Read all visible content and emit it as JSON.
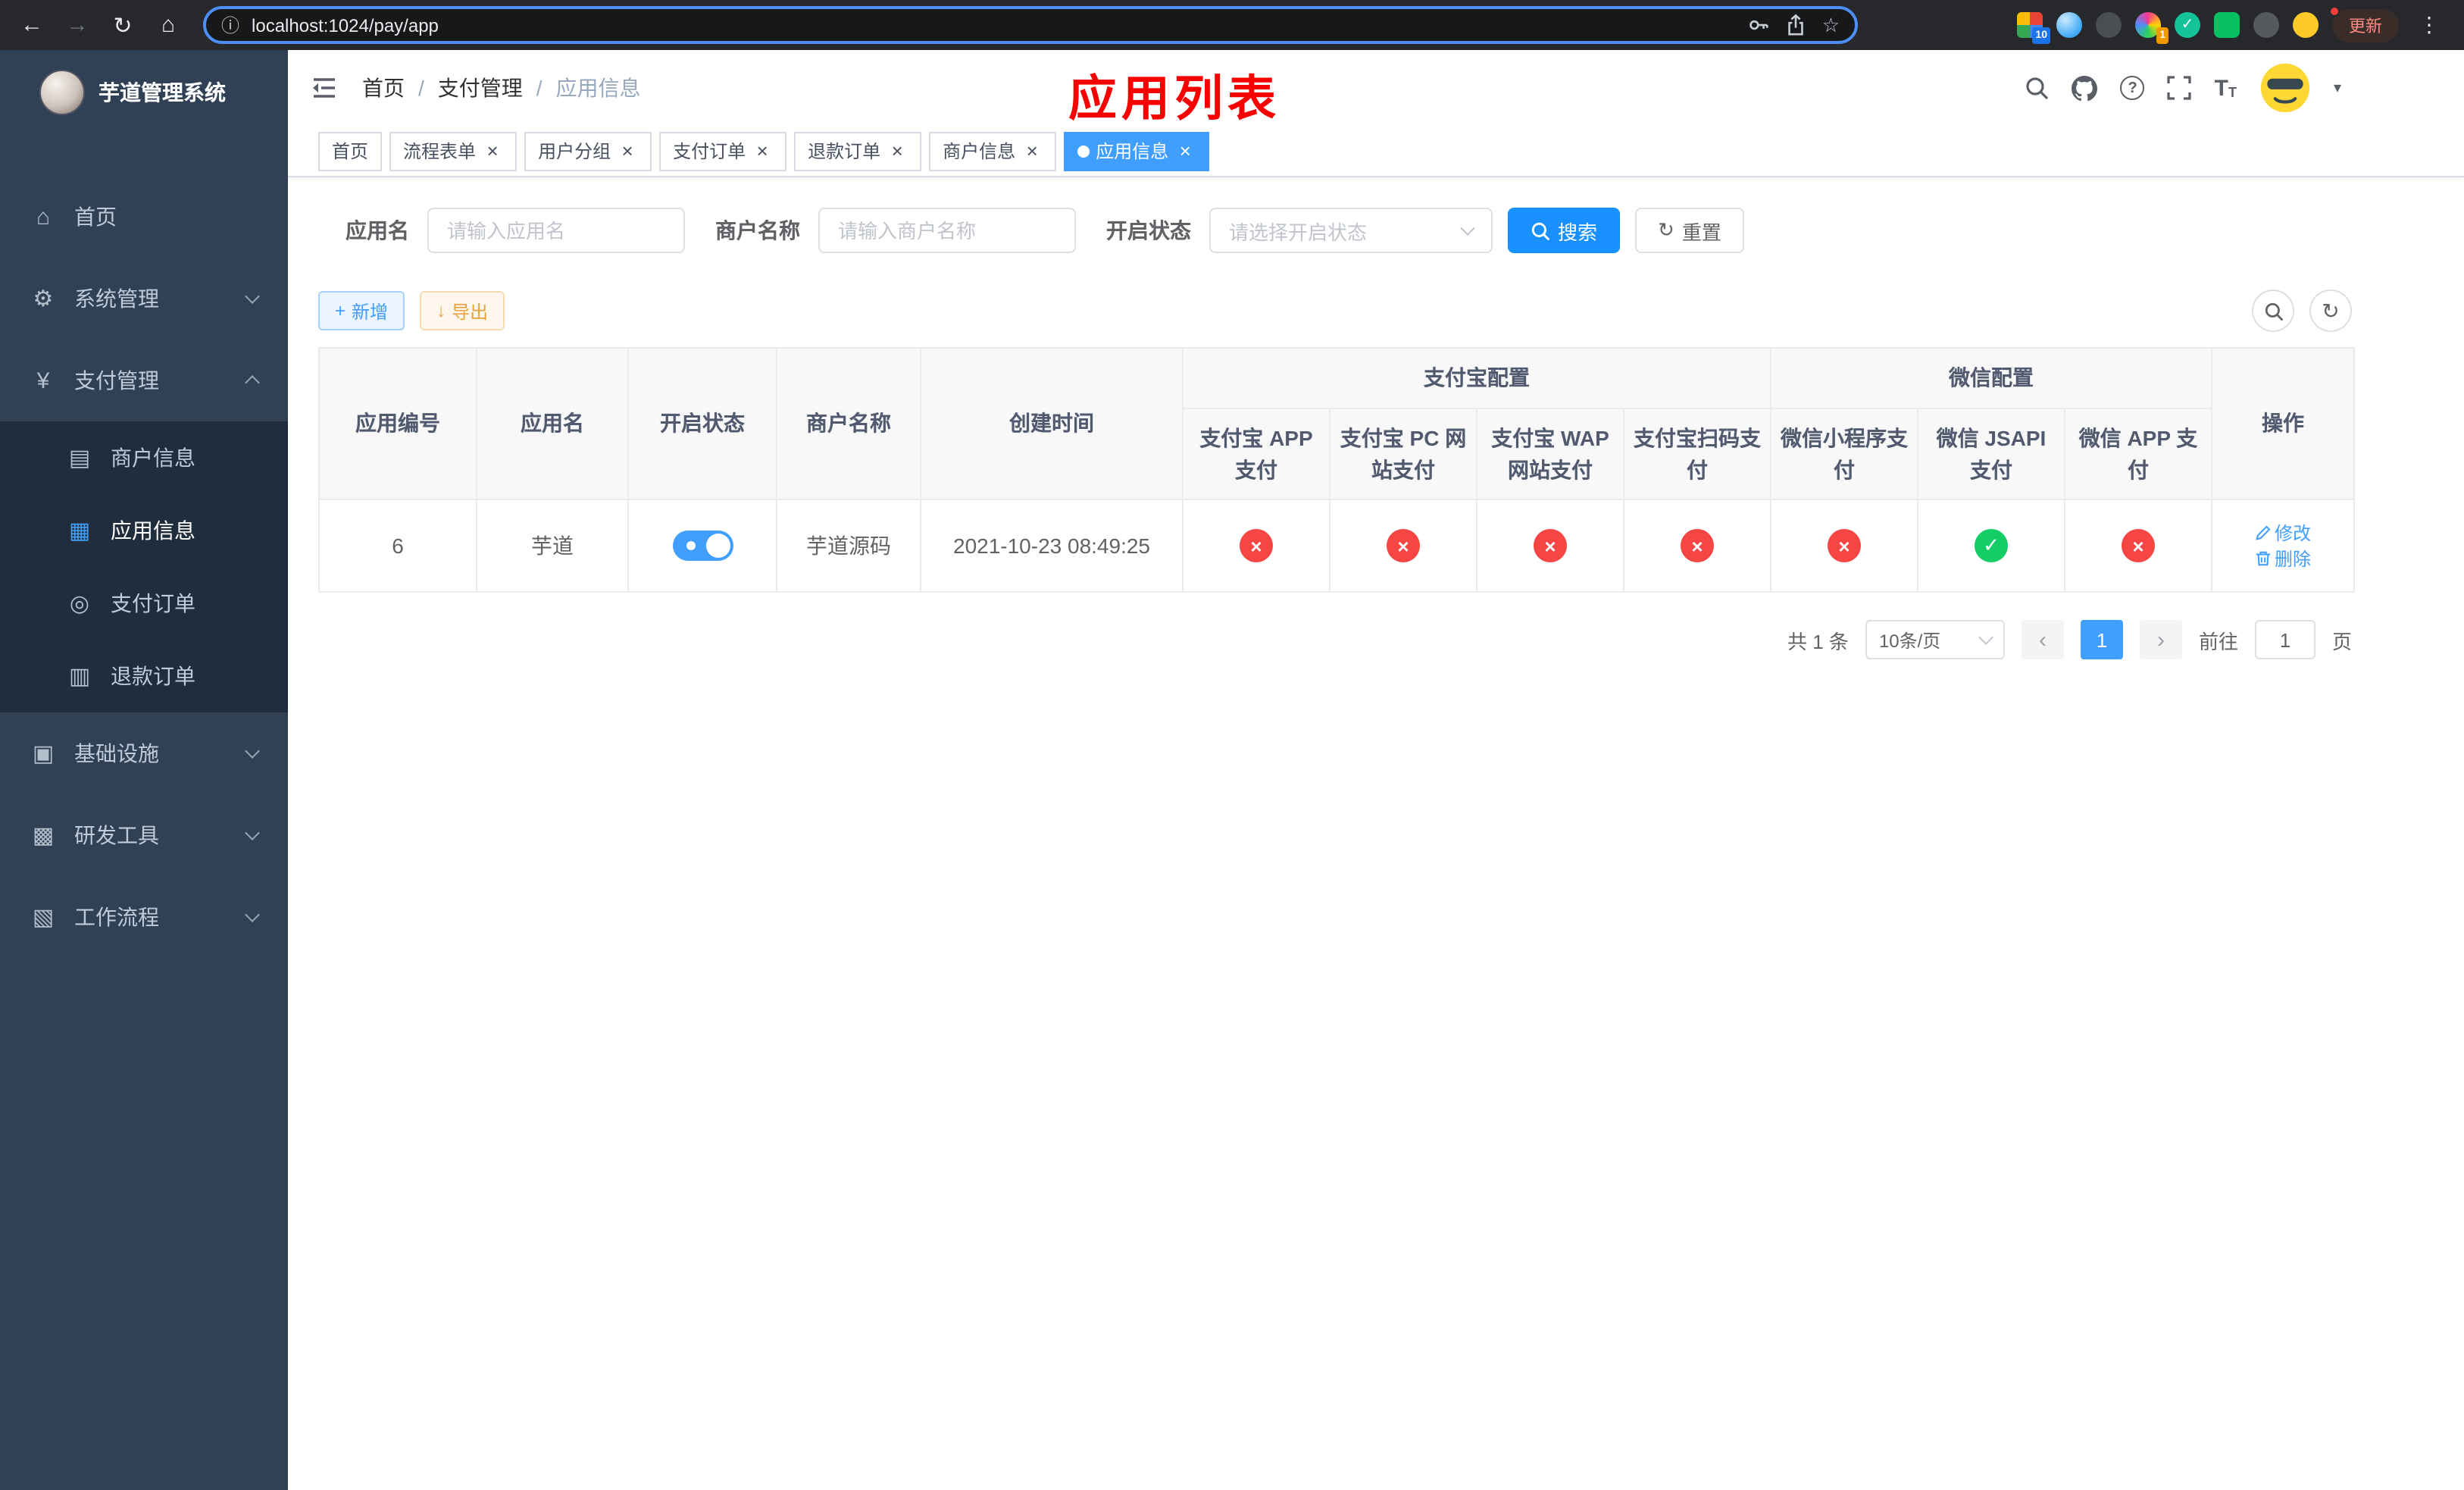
{
  "colors": {
    "primary": "#409eff",
    "search_button": "#1890ff",
    "success": "#13ce66",
    "danger": "#f54643",
    "warning": "#e6a23c",
    "annotation": "#f80000",
    "sidebar_bg": "#304156",
    "submenu_bg": "#1f2d3d"
  },
  "icons": {
    "back": "←",
    "forward": "→",
    "reload": "↻",
    "home": "⌂",
    "info": "ⓘ",
    "star": "☆",
    "menu_dots": "⋮",
    "grammarly_check": "✓",
    "close": "×",
    "caret_down": "▾",
    "question": "?",
    "font_big": "T",
    "font_small": "T",
    "dashboard": "⌂",
    "gear": "⚙",
    "yen": "¥",
    "merchant": "▤",
    "app": "▦",
    "order": "◎",
    "refund": "▥",
    "infra": "▣",
    "devtool": "▩",
    "workflow": "▧",
    "plus": "+",
    "download": "↓",
    "refresh": "↻",
    "check": "✓",
    "cross": "×",
    "prev": "‹",
    "next": "›"
  },
  "browser": {
    "url": "localhost:1024/pay/app",
    "update_label": "更新",
    "ext_badge_grid": "10",
    "ext_badge_avatar": "1"
  },
  "sidebar": {
    "title": "芋道管理系统",
    "menu": [
      {
        "label": "首页"
      },
      {
        "label": "系统管理"
      },
      {
        "label": "支付管理"
      },
      {
        "label": "基础设施"
      },
      {
        "label": "研发工具"
      },
      {
        "label": "工作流程"
      }
    ],
    "submenu": [
      {
        "label": "商户信息"
      },
      {
        "label": "应用信息"
      },
      {
        "label": "支付订单"
      },
      {
        "label": "退款订单"
      }
    ]
  },
  "header": {
    "breadcrumb": [
      {
        "label": "首页"
      },
      {
        "label": "支付管理"
      },
      {
        "label": "应用信息"
      }
    ],
    "separator": "/",
    "annotation": "应用列表"
  },
  "tabs": [
    {
      "label": "首页"
    },
    {
      "label": "流程表单"
    },
    {
      "label": "用户分组"
    },
    {
      "label": "支付订单"
    },
    {
      "label": "退款订单"
    },
    {
      "label": "商户信息"
    },
    {
      "label": "应用信息"
    }
  ],
  "filters": {
    "app_name_label": "应用名",
    "app_name_placeholder": "请输入应用名",
    "merchant_label": "商户名称",
    "merchant_placeholder": "请输入商户名称",
    "status_label": "开启状态",
    "status_placeholder": "请选择开启状态",
    "search_label": "搜索",
    "reset_label": "重置"
  },
  "toolbar": {
    "add_label": "新增",
    "export_label": "导出"
  },
  "table": {
    "group_alipay": "支付宝配置",
    "group_wechat": "微信配置",
    "col_id": "应用编号",
    "col_name": "应用名",
    "col_status": "开启状态",
    "col_merchant": "商户名称",
    "col_created": "创建时间",
    "col_pay": [
      "支付宝 APP 支付",
      "支付宝 PC 网站支付",
      "支付宝 WAP 网站支付",
      "支付宝扫码支付",
      "微信小程序支付",
      "微信 JSAPI 支付",
      "微信 APP 支付"
    ],
    "col_actions": "操作",
    "row": {
      "id": "6",
      "name": "芋道",
      "enabled": true,
      "merchant": "芋道源码",
      "created": "2021-10-23 08:49:25",
      "statuses": [
        "fail",
        "fail",
        "fail",
        "fail",
        "fail",
        "ok",
        "fail"
      ],
      "edit_label": "修改",
      "delete_label": "删除"
    }
  },
  "pagination": {
    "total": "共 1 条",
    "page_size": "10条/页",
    "page": "1",
    "goto_label": "前往",
    "goto_value": "1",
    "unit_label": "页"
  }
}
